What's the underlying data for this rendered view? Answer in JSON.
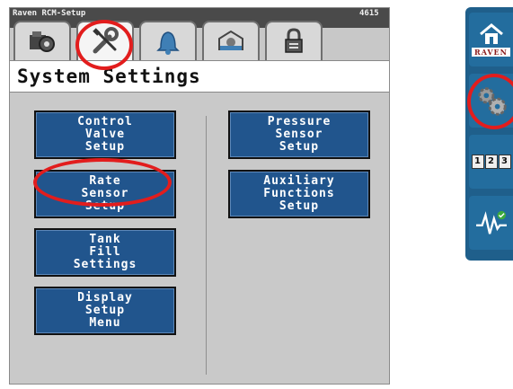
{
  "window": {
    "app_title": "Raven RCM-Setup",
    "code": "4615"
  },
  "tabs": [
    {
      "icon": "machine-gear-icon"
    },
    {
      "icon": "wrench-screwdriver-icon",
      "active": true
    },
    {
      "icon": "bell-icon"
    },
    {
      "icon": "tank-gear-icon"
    },
    {
      "icon": "lock-icon"
    }
  ],
  "header": {
    "title": "System Settings"
  },
  "buttons": {
    "control_valve_setup": "Control\nValve\nSetup",
    "rate_sensor_setup": "Rate\nSensor\nSetup",
    "tank_fill_settings": "Tank\nFill\nSettings",
    "display_setup_menu": "Display\nSetup\nMenu",
    "pressure_sensor_setup": "Pressure\nSensor\nSetup",
    "auxiliary_functions_setup": "Auxiliary\nFunctions\nSetup"
  },
  "side": {
    "home_label": "RAVEN",
    "numbers": [
      "1",
      "2",
      "3"
    ]
  },
  "colors": {
    "button_blue": "#21558d",
    "highlight_red": "#e21d1d",
    "side_blue": "#1f5f8b"
  }
}
